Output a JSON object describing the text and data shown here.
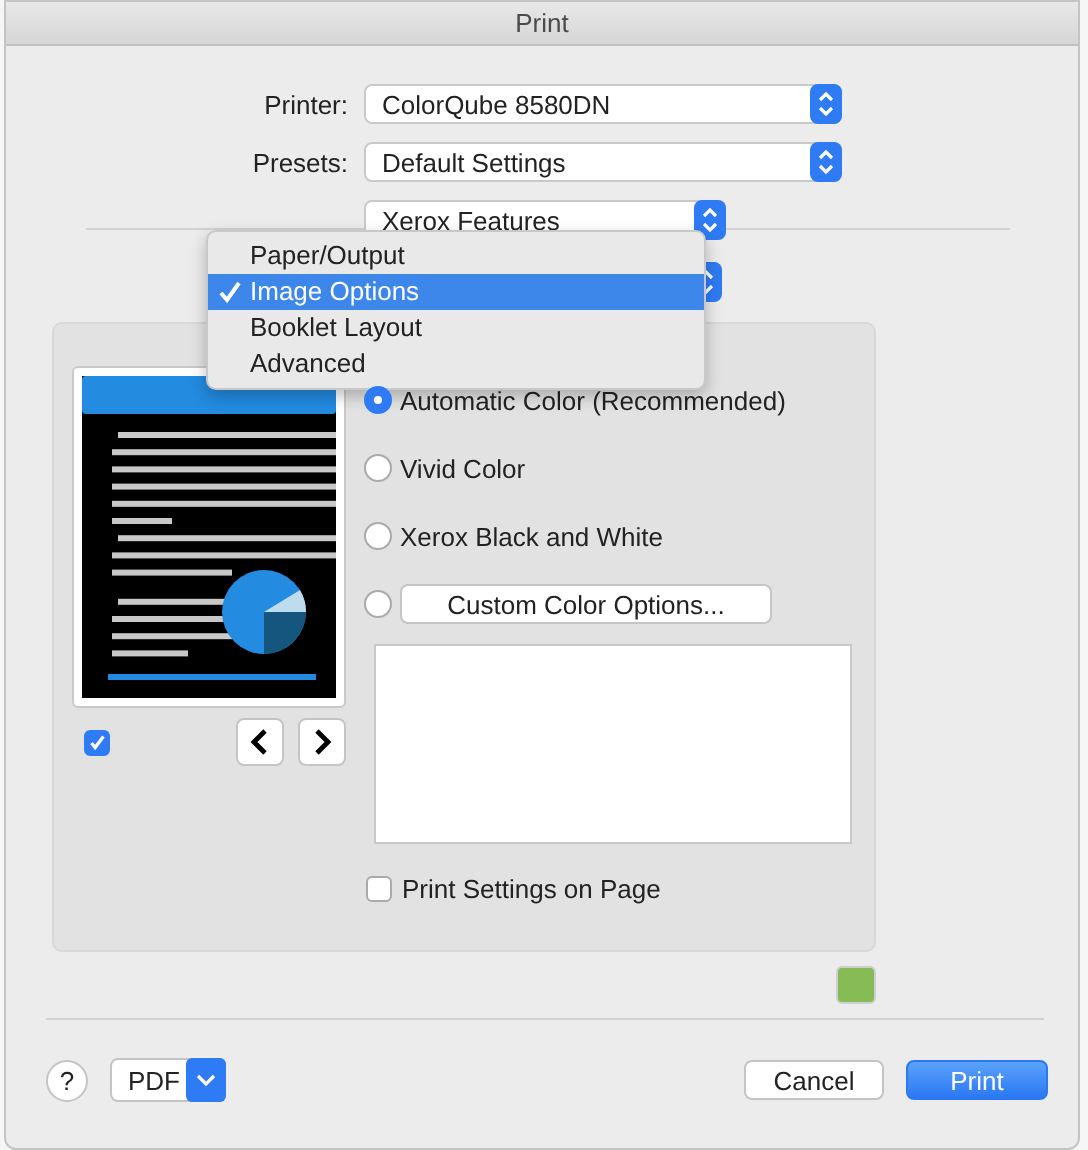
{
  "window": {
    "title": "Print"
  },
  "printer": {
    "label": "Printer:",
    "value": "ColorQube 8580DN"
  },
  "presets": {
    "label": "Presets:",
    "value": "Default Settings"
  },
  "feature_set": {
    "value": "Xerox Features"
  },
  "section_menu": {
    "items": [
      {
        "label": "Paper/Output",
        "selected": false
      },
      {
        "label": "Image Options",
        "selected": true
      },
      {
        "label": "Booklet Layout",
        "selected": false
      },
      {
        "label": "Advanced",
        "selected": false
      }
    ]
  },
  "preview": {
    "checked": true
  },
  "color_options": [
    {
      "kind": "radio",
      "label": "Automatic Color (Recommended)",
      "selected": true
    },
    {
      "kind": "radio",
      "label": "Vivid Color",
      "selected": false
    },
    {
      "kind": "radio",
      "label": "Xerox Black and White",
      "selected": false
    },
    {
      "kind": "button",
      "label": "Custom Color Options...",
      "selected": false
    }
  ],
  "print_settings_on_page": {
    "label": "Print Settings on Page",
    "checked": false
  },
  "buttons": {
    "help": "?",
    "pdf": "PDF",
    "cancel": "Cancel",
    "print": "Print"
  }
}
